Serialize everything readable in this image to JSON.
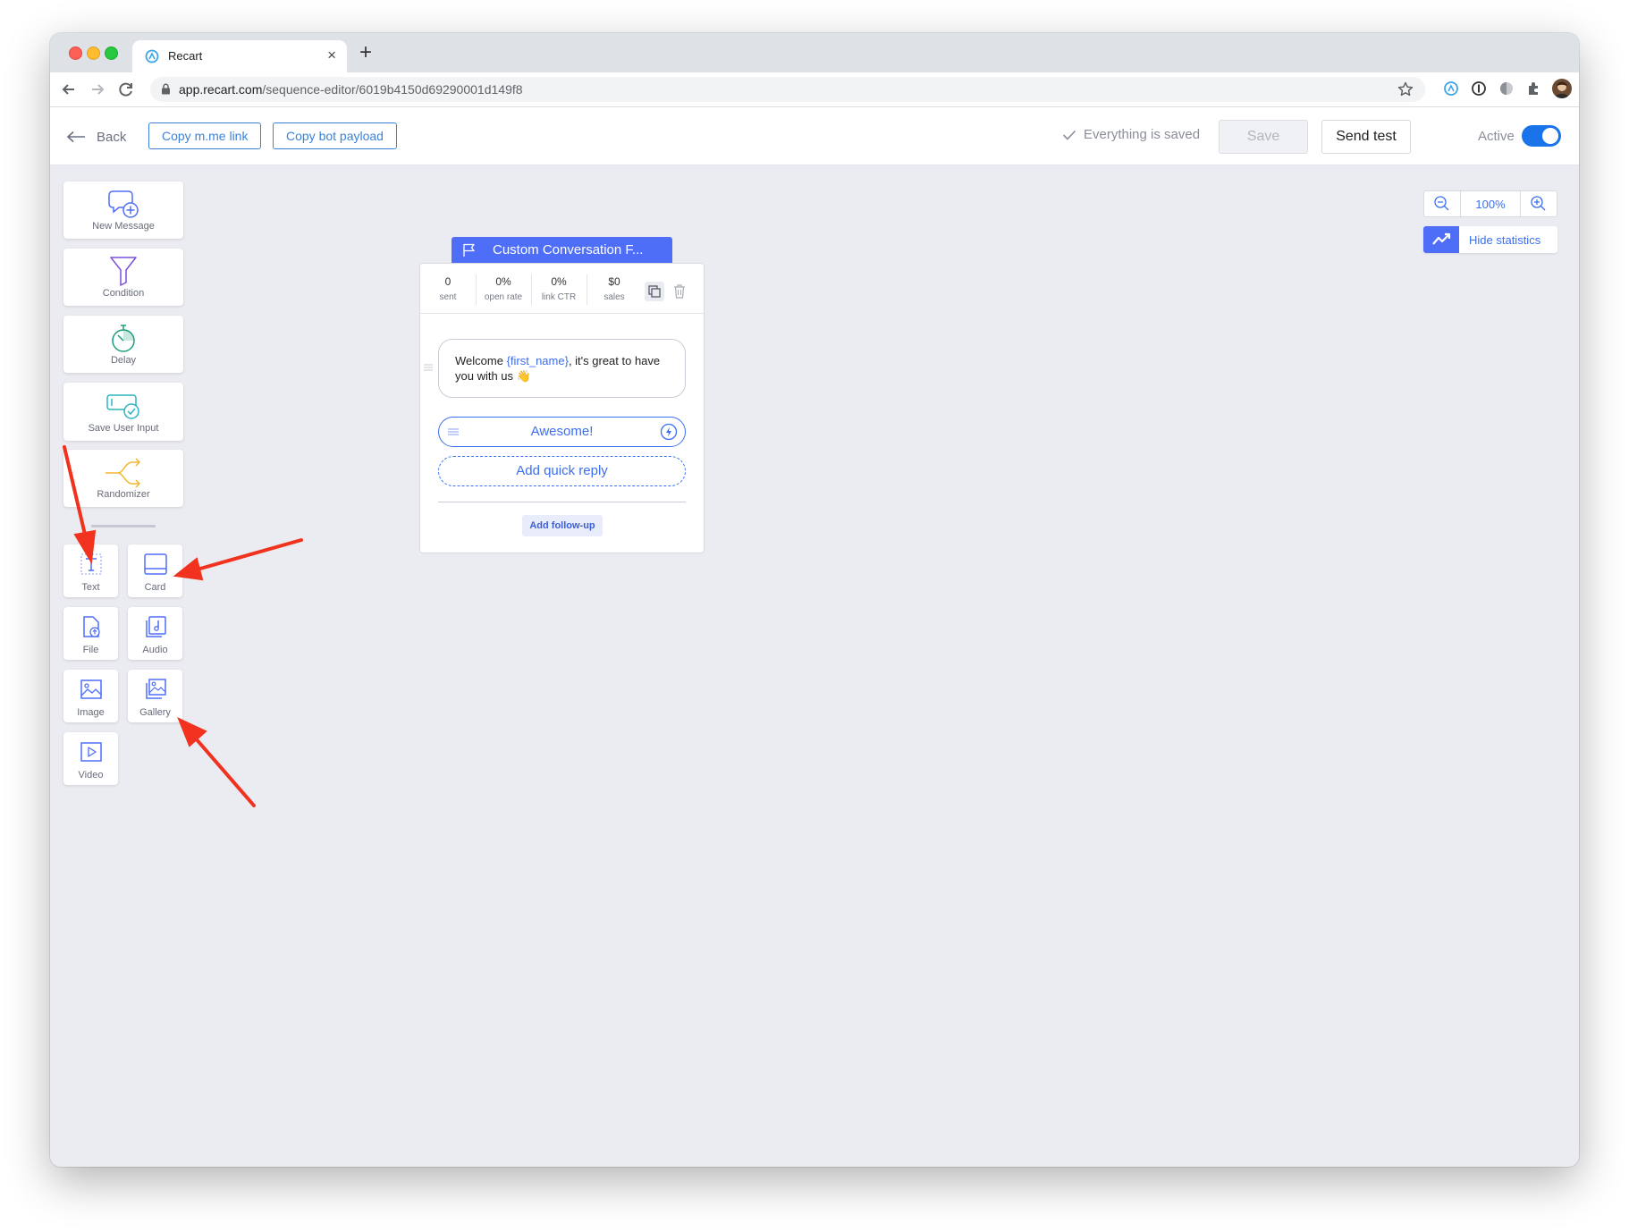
{
  "browser": {
    "tab_title": "Recart",
    "tab_close": "×",
    "new_tab": "+",
    "url_host": "app.recart.com",
    "url_path": "/sequence-editor/6019b4150d69290001d149f8"
  },
  "header": {
    "back_label": "Back",
    "copy_mme_label": "Copy m.me link",
    "copy_payload_label": "Copy bot payload",
    "saved_status": "Everything is saved",
    "save_label": "Save",
    "send_test_label": "Send test",
    "active_label": "Active",
    "active": true
  },
  "tools": [
    {
      "label": "New Message",
      "icon": "new-message-icon"
    },
    {
      "label": "Condition",
      "icon": "funnel-icon"
    },
    {
      "label": "Delay",
      "icon": "stopwatch-icon"
    },
    {
      "label": "Save User Input",
      "icon": "save-input-icon"
    },
    {
      "label": "Randomizer",
      "icon": "randomizer-icon"
    }
  ],
  "content_blocks": [
    {
      "label": "Text",
      "icon": "text-icon"
    },
    {
      "label": "Card",
      "icon": "card-icon"
    },
    {
      "label": "File",
      "icon": "file-icon"
    },
    {
      "label": "Audio",
      "icon": "audio-icon"
    },
    {
      "label": "Image",
      "icon": "image-icon"
    },
    {
      "label": "Gallery",
      "icon": "gallery-icon"
    },
    {
      "label": "Video",
      "icon": "video-icon"
    }
  ],
  "node": {
    "title": "Custom Conversation F...",
    "stats": [
      {
        "value": "0",
        "label": "sent"
      },
      {
        "value": "0%",
        "label": "open rate"
      },
      {
        "value": "0%",
        "label": "link CTR"
      },
      {
        "value": "$0",
        "label": "sales"
      }
    ],
    "message_pre": "Welcome ",
    "message_var": "{first_name}",
    "message_post": ", it's great to have you with us ",
    "message_emoji": "👋",
    "quick_reply": "Awesome!",
    "add_quick_reply": "Add quick reply",
    "add_follow_up": "Add follow-up"
  },
  "zoom": {
    "value": "100%",
    "hide_statistics_label": "Hide statistics"
  },
  "colors": {
    "accent": "#4f6ef7",
    "link": "#3b6ef0",
    "annotation_arrow": "#f0321e"
  }
}
